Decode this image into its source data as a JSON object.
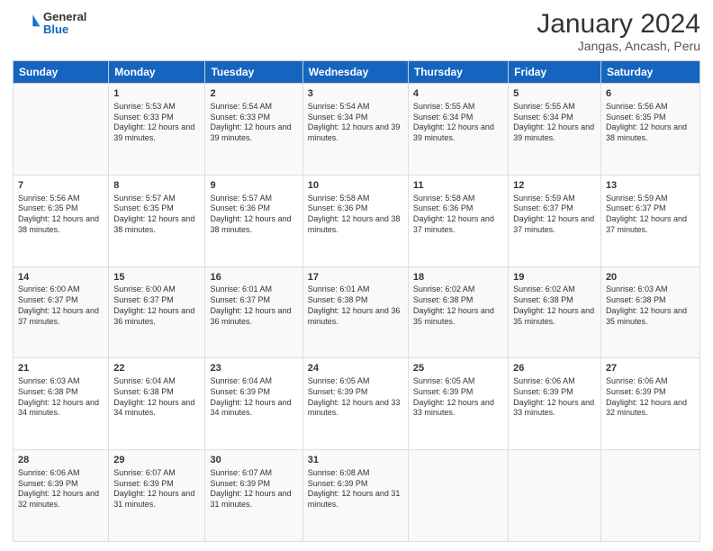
{
  "header": {
    "logo": {
      "general": "General",
      "blue": "Blue"
    },
    "title": "January 2024",
    "subtitle": "Jangas, Ancash, Peru"
  },
  "days": [
    "Sunday",
    "Monday",
    "Tuesday",
    "Wednesday",
    "Thursday",
    "Friday",
    "Saturday"
  ],
  "weeks": [
    [
      {
        "num": "",
        "sunrise": "",
        "sunset": "",
        "daylight": ""
      },
      {
        "num": "1",
        "sunrise": "Sunrise: 5:53 AM",
        "sunset": "Sunset: 6:33 PM",
        "daylight": "Daylight: 12 hours and 39 minutes."
      },
      {
        "num": "2",
        "sunrise": "Sunrise: 5:54 AM",
        "sunset": "Sunset: 6:33 PM",
        "daylight": "Daylight: 12 hours and 39 minutes."
      },
      {
        "num": "3",
        "sunrise": "Sunrise: 5:54 AM",
        "sunset": "Sunset: 6:34 PM",
        "daylight": "Daylight: 12 hours and 39 minutes."
      },
      {
        "num": "4",
        "sunrise": "Sunrise: 5:55 AM",
        "sunset": "Sunset: 6:34 PM",
        "daylight": "Daylight: 12 hours and 39 minutes."
      },
      {
        "num": "5",
        "sunrise": "Sunrise: 5:55 AM",
        "sunset": "Sunset: 6:34 PM",
        "daylight": "Daylight: 12 hours and 39 minutes."
      },
      {
        "num": "6",
        "sunrise": "Sunrise: 5:56 AM",
        "sunset": "Sunset: 6:35 PM",
        "daylight": "Daylight: 12 hours and 38 minutes."
      }
    ],
    [
      {
        "num": "7",
        "sunrise": "Sunrise: 5:56 AM",
        "sunset": "Sunset: 6:35 PM",
        "daylight": "Daylight: 12 hours and 38 minutes."
      },
      {
        "num": "8",
        "sunrise": "Sunrise: 5:57 AM",
        "sunset": "Sunset: 6:35 PM",
        "daylight": "Daylight: 12 hours and 38 minutes."
      },
      {
        "num": "9",
        "sunrise": "Sunrise: 5:57 AM",
        "sunset": "Sunset: 6:36 PM",
        "daylight": "Daylight: 12 hours and 38 minutes."
      },
      {
        "num": "10",
        "sunrise": "Sunrise: 5:58 AM",
        "sunset": "Sunset: 6:36 PM",
        "daylight": "Daylight: 12 hours and 38 minutes."
      },
      {
        "num": "11",
        "sunrise": "Sunrise: 5:58 AM",
        "sunset": "Sunset: 6:36 PM",
        "daylight": "Daylight: 12 hours and 37 minutes."
      },
      {
        "num": "12",
        "sunrise": "Sunrise: 5:59 AM",
        "sunset": "Sunset: 6:37 PM",
        "daylight": "Daylight: 12 hours and 37 minutes."
      },
      {
        "num": "13",
        "sunrise": "Sunrise: 5:59 AM",
        "sunset": "Sunset: 6:37 PM",
        "daylight": "Daylight: 12 hours and 37 minutes."
      }
    ],
    [
      {
        "num": "14",
        "sunrise": "Sunrise: 6:00 AM",
        "sunset": "Sunset: 6:37 PM",
        "daylight": "Daylight: 12 hours and 37 minutes."
      },
      {
        "num": "15",
        "sunrise": "Sunrise: 6:00 AM",
        "sunset": "Sunset: 6:37 PM",
        "daylight": "Daylight: 12 hours and 36 minutes."
      },
      {
        "num": "16",
        "sunrise": "Sunrise: 6:01 AM",
        "sunset": "Sunset: 6:37 PM",
        "daylight": "Daylight: 12 hours and 36 minutes."
      },
      {
        "num": "17",
        "sunrise": "Sunrise: 6:01 AM",
        "sunset": "Sunset: 6:38 PM",
        "daylight": "Daylight: 12 hours and 36 minutes."
      },
      {
        "num": "18",
        "sunrise": "Sunrise: 6:02 AM",
        "sunset": "Sunset: 6:38 PM",
        "daylight": "Daylight: 12 hours and 35 minutes."
      },
      {
        "num": "19",
        "sunrise": "Sunrise: 6:02 AM",
        "sunset": "Sunset: 6:38 PM",
        "daylight": "Daylight: 12 hours and 35 minutes."
      },
      {
        "num": "20",
        "sunrise": "Sunrise: 6:03 AM",
        "sunset": "Sunset: 6:38 PM",
        "daylight": "Daylight: 12 hours and 35 minutes."
      }
    ],
    [
      {
        "num": "21",
        "sunrise": "Sunrise: 6:03 AM",
        "sunset": "Sunset: 6:38 PM",
        "daylight": "Daylight: 12 hours and 34 minutes."
      },
      {
        "num": "22",
        "sunrise": "Sunrise: 6:04 AM",
        "sunset": "Sunset: 6:38 PM",
        "daylight": "Daylight: 12 hours and 34 minutes."
      },
      {
        "num": "23",
        "sunrise": "Sunrise: 6:04 AM",
        "sunset": "Sunset: 6:39 PM",
        "daylight": "Daylight: 12 hours and 34 minutes."
      },
      {
        "num": "24",
        "sunrise": "Sunrise: 6:05 AM",
        "sunset": "Sunset: 6:39 PM",
        "daylight": "Daylight: 12 hours and 33 minutes."
      },
      {
        "num": "25",
        "sunrise": "Sunrise: 6:05 AM",
        "sunset": "Sunset: 6:39 PM",
        "daylight": "Daylight: 12 hours and 33 minutes."
      },
      {
        "num": "26",
        "sunrise": "Sunrise: 6:06 AM",
        "sunset": "Sunset: 6:39 PM",
        "daylight": "Daylight: 12 hours and 33 minutes."
      },
      {
        "num": "27",
        "sunrise": "Sunrise: 6:06 AM",
        "sunset": "Sunset: 6:39 PM",
        "daylight": "Daylight: 12 hours and 32 minutes."
      }
    ],
    [
      {
        "num": "28",
        "sunrise": "Sunrise: 6:06 AM",
        "sunset": "Sunset: 6:39 PM",
        "daylight": "Daylight: 12 hours and 32 minutes."
      },
      {
        "num": "29",
        "sunrise": "Sunrise: 6:07 AM",
        "sunset": "Sunset: 6:39 PM",
        "daylight": "Daylight: 12 hours and 31 minutes."
      },
      {
        "num": "30",
        "sunrise": "Sunrise: 6:07 AM",
        "sunset": "Sunset: 6:39 PM",
        "daylight": "Daylight: 12 hours and 31 minutes."
      },
      {
        "num": "31",
        "sunrise": "Sunrise: 6:08 AM",
        "sunset": "Sunset: 6:39 PM",
        "daylight": "Daylight: 12 hours and 31 minutes."
      },
      {
        "num": "",
        "sunrise": "",
        "sunset": "",
        "daylight": ""
      },
      {
        "num": "",
        "sunrise": "",
        "sunset": "",
        "daylight": ""
      },
      {
        "num": "",
        "sunrise": "",
        "sunset": "",
        "daylight": ""
      }
    ]
  ]
}
